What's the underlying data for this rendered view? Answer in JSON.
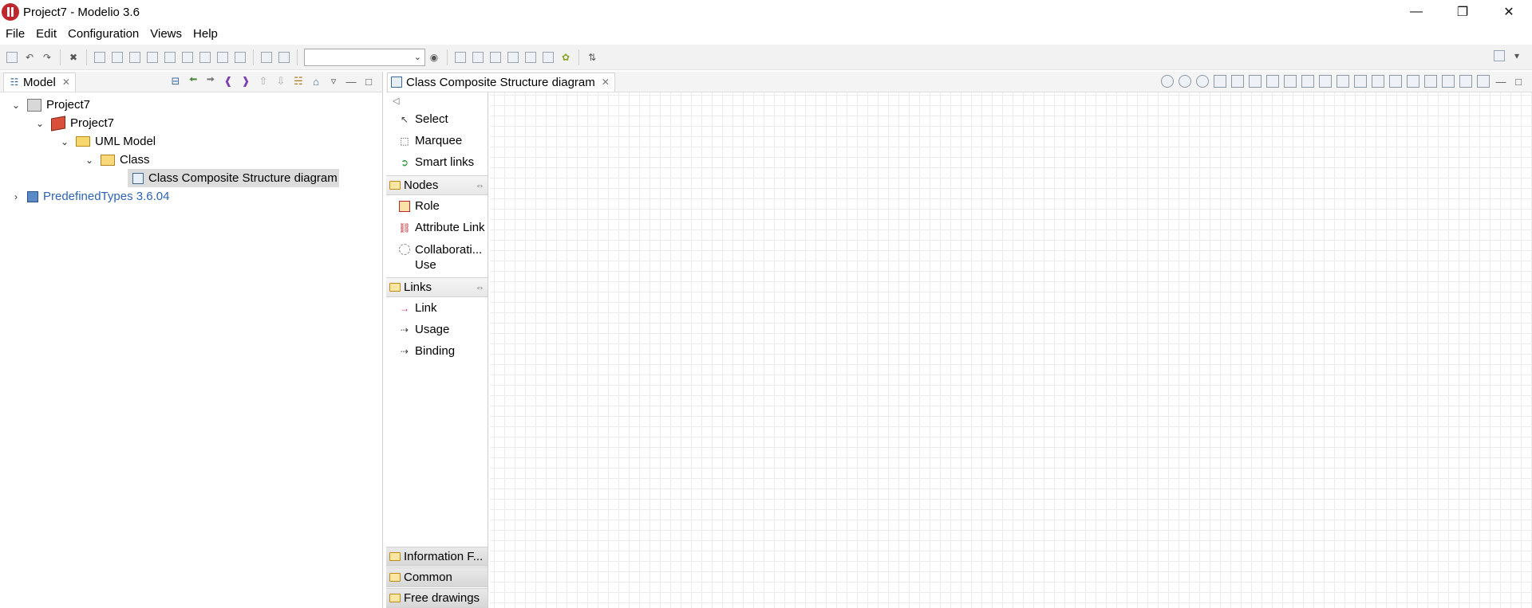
{
  "window": {
    "title": "Project7 - Modelio 3.6",
    "minimize_label": "—",
    "maximize_label": "❐",
    "close_label": "✕"
  },
  "menu": [
    "File",
    "Edit",
    "Configuration",
    "Views",
    "Help"
  ],
  "toolbar": {
    "combo_value": "",
    "combo_arrow": "⌄"
  },
  "model_panel": {
    "tab_label": "Model",
    "close_label": "✕"
  },
  "tree": [
    {
      "label": "Project7",
      "icon": "project-icon"
    },
    {
      "label": "Project7",
      "icon": "package-icon"
    },
    {
      "label": "UML Model",
      "icon": "folder-icon"
    },
    {
      "label": "Class",
      "icon": "class-icon"
    },
    {
      "label": "Class Composite Structure diagram",
      "icon": "diagram-icon"
    },
    {
      "label": "PredefinedTypes 3.6.04",
      "icon": "types-icon"
    }
  ],
  "editor": {
    "tab_label": "Class Composite Structure diagram",
    "close_label": "✕"
  },
  "palette": {
    "collapse_label": "◁",
    "tools": [
      "Select",
      "Marquee",
      "Smart links"
    ],
    "groups": [
      {
        "label": "Nodes",
        "items": [
          "Role",
          "Attribute Link",
          "Collaborati...",
          "Use"
        ]
      },
      {
        "label": "Links",
        "items": [
          "Link",
          "Usage",
          "Binding"
        ]
      }
    ],
    "bottom_groups": [
      "Information F...",
      "Common",
      "Free drawings"
    ],
    "pin_label": "⇔"
  },
  "colors": {
    "accent_red": "#c0272d",
    "link_blue": "#2e63b8",
    "selection_gray": "#dcdcdc"
  }
}
